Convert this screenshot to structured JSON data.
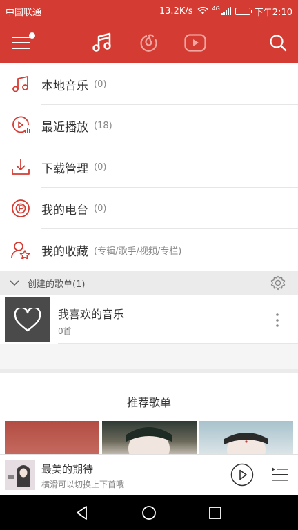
{
  "status_bar": {
    "carrier": "中国联通",
    "speed": "13.2K/s",
    "network": "4G",
    "time": "下午2:10"
  },
  "header": {
    "tabs": [
      "music-note-icon",
      "netease-cloud-icon",
      "video-play-icon"
    ],
    "active_tab_index": 0
  },
  "menu": {
    "items": [
      {
        "icon": "music-note-icon",
        "label": "本地音乐",
        "count": "(0)"
      },
      {
        "icon": "recent-play-icon",
        "label": "最近播放",
        "count": "(18)"
      },
      {
        "icon": "download-icon",
        "label": "下载管理",
        "count": "(0)"
      },
      {
        "icon": "radio-icon",
        "label": "我的电台",
        "count": "(0)"
      },
      {
        "icon": "favorites-icon",
        "label": "我的收藏",
        "count": "(专辑/歌手/视频/专栏)"
      }
    ]
  },
  "created_playlists": {
    "title": "创建的歌单(1)",
    "items": [
      {
        "title": "我喜欢的音乐",
        "count": "0首"
      }
    ]
  },
  "recommend": {
    "title": "推荐歌单"
  },
  "player": {
    "title": "最美的期待",
    "subtitle": "横滑可以切换上下首哦"
  },
  "colors": {
    "brand_red": "#d43c33",
    "section_gray": "#ebebeb"
  }
}
